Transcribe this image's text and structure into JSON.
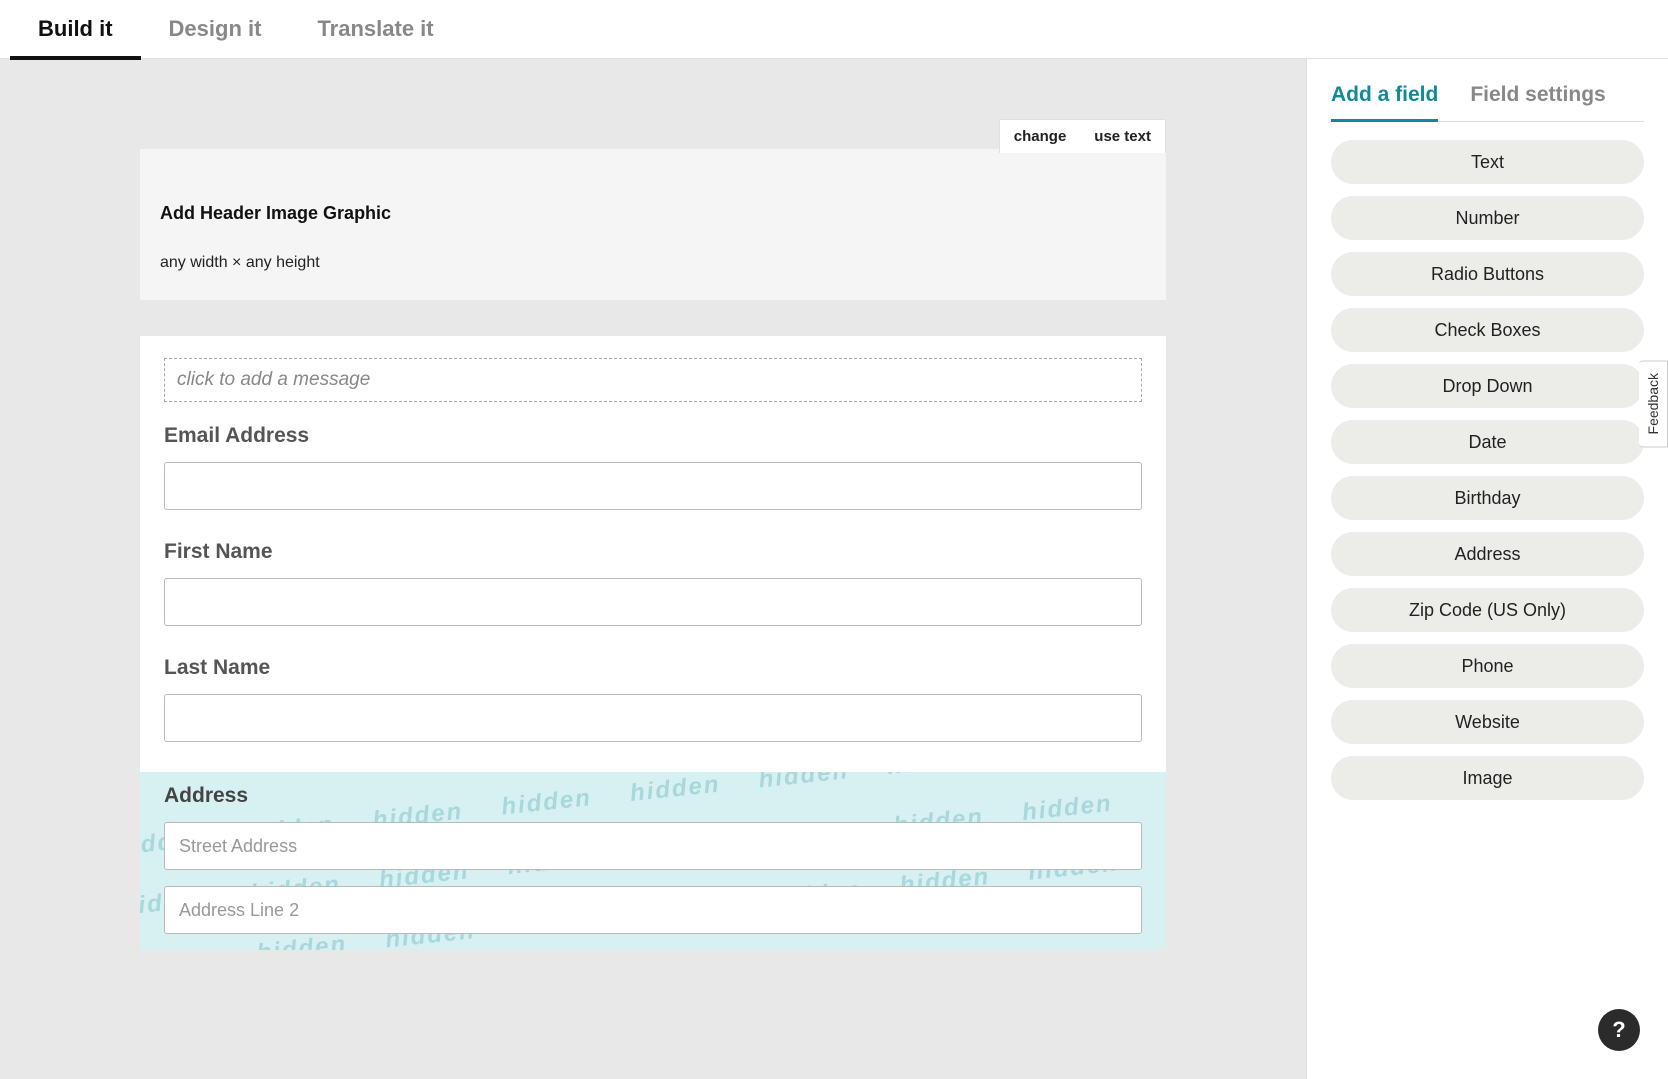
{
  "topTabs": {
    "build": "Build it",
    "design": "Design it",
    "translate": "Translate it"
  },
  "headerBlock": {
    "changeLabel": "change",
    "useTextLabel": "use text",
    "title": "Add Header Image Graphic",
    "dims": "any width × any height"
  },
  "form": {
    "messagePlaceholder": "click to add a message",
    "fields": [
      {
        "label": "Email Address"
      },
      {
        "label": "First Name"
      },
      {
        "label": "Last Name"
      }
    ],
    "address": {
      "label": "Address",
      "street_placeholder": "Street Address",
      "line2_placeholder": "Address Line 2"
    }
  },
  "sidebar": {
    "tabs": {
      "add": "Add a field",
      "settings": "Field settings"
    },
    "fieldTypes": [
      "Text",
      "Number",
      "Radio Buttons",
      "Check Boxes",
      "Drop Down",
      "Date",
      "Birthday",
      "Address",
      "Zip Code (US Only)",
      "Phone",
      "Website",
      "Image"
    ]
  },
  "feedback": "Feedback",
  "help": "?"
}
